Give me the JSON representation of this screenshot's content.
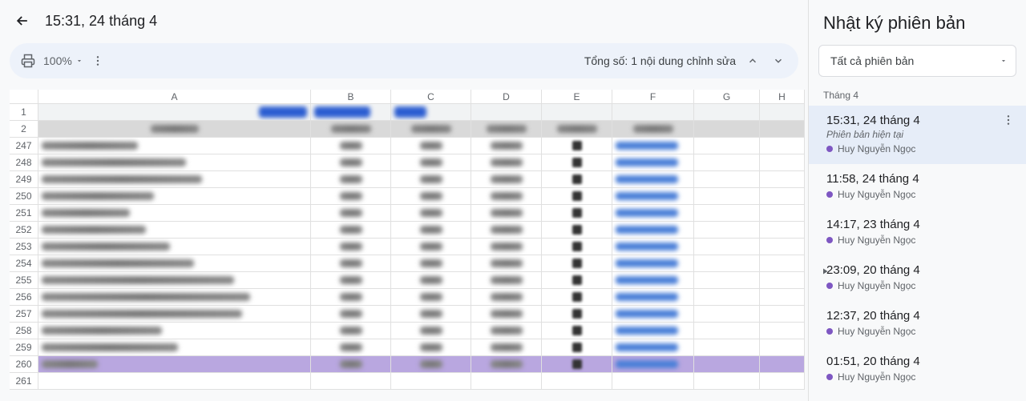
{
  "header": {
    "title": "15:31, 24 tháng 4"
  },
  "toolbar": {
    "zoom": "100%",
    "total_text": "Tổng số: 1 nội dung chỉnh sửa"
  },
  "columns": [
    "A",
    "B",
    "C",
    "D",
    "E",
    "F",
    "G",
    "H"
  ],
  "top_rows": [
    "1",
    "2"
  ],
  "data_rows": [
    "247",
    "248",
    "249",
    "250",
    "251",
    "252",
    "253",
    "254",
    "255",
    "256",
    "257",
    "258",
    "259",
    "260",
    "261"
  ],
  "panel": {
    "title": "Nhật ký phiên bản",
    "dropdown_label": "Tất cả phiên bản",
    "month": "Tháng 4"
  },
  "versions": [
    {
      "time": "15:31, 24 tháng 4",
      "sub": "Phiên bản hiện tại",
      "editor": "Huy Nguyễn Ngọc",
      "active": true,
      "more": true
    },
    {
      "time": "11:58, 24 tháng 4",
      "editor": "Huy Nguyễn Ngọc"
    },
    {
      "time": "14:17, 23 tháng 4",
      "editor": "Huy Nguyễn Ngọc"
    },
    {
      "time": "23:09, 20 tháng 4",
      "editor": "Huy Nguyễn Ngọc",
      "expand": true
    },
    {
      "time": "12:37, 20 tháng 4",
      "editor": "Huy Nguyễn Ngọc"
    },
    {
      "time": "01:51, 20 tháng 4",
      "editor": "Huy Nguyễn Ngọc"
    }
  ]
}
